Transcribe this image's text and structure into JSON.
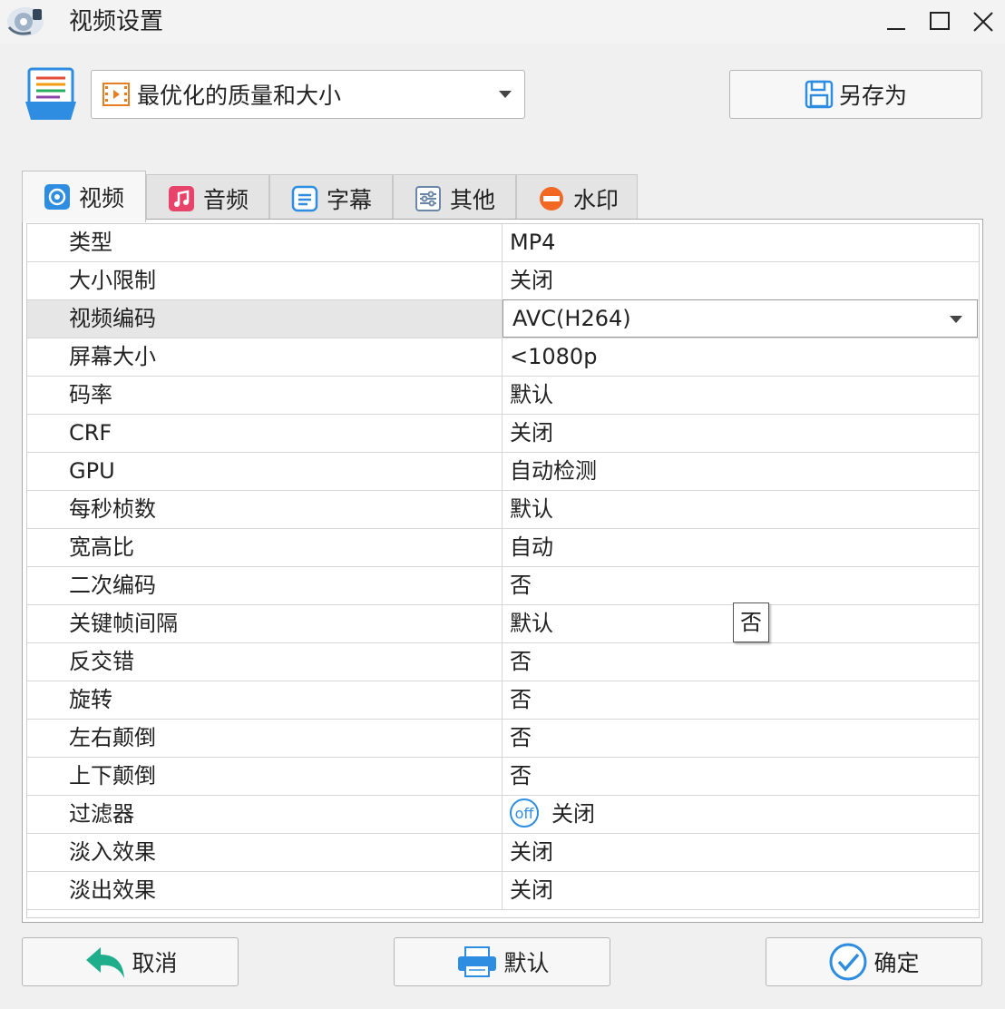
{
  "window": {
    "title": "视频设置",
    "icons": {
      "app": "converter-app-icon",
      "minimize": "minimize-icon",
      "maximize": "maximize-icon",
      "close": "close-icon"
    }
  },
  "preset": {
    "selected": "最优化的质量和大小",
    "icon": "film-icon",
    "save_as_label": "另存为"
  },
  "tabs": [
    {
      "label": "视频",
      "icon": "video-icon",
      "active": true
    },
    {
      "label": "音频",
      "icon": "music-note-icon",
      "active": false
    },
    {
      "label": "字幕",
      "icon": "subtitle-icon",
      "active": false
    },
    {
      "label": "其他",
      "icon": "sliders-icon",
      "active": false
    },
    {
      "label": "水印",
      "icon": "watermark-icon",
      "active": false
    }
  ],
  "settings": [
    {
      "key": "类型",
      "value": "MP4"
    },
    {
      "key": "大小限制",
      "value": "关闭"
    },
    {
      "key": "视频编码",
      "value": "AVC(H264)"
    },
    {
      "key": "屏幕大小",
      "value": "<1080p"
    },
    {
      "key": "码率",
      "value": "默认"
    },
    {
      "key": "CRF",
      "value": "关闭"
    },
    {
      "key": "GPU",
      "value": "自动检测"
    },
    {
      "key": "每秒桢数",
      "value": "默认"
    },
    {
      "key": "宽高比",
      "value": "自动"
    },
    {
      "key": "二次编码",
      "value": "否"
    },
    {
      "key": "关键帧间隔",
      "value": "默认"
    },
    {
      "key": "反交错",
      "value": "否"
    },
    {
      "key": "旋转",
      "value": "否"
    },
    {
      "key": "左右颠倒",
      "value": "否"
    },
    {
      "key": "上下颠倒",
      "value": "否"
    },
    {
      "key": "过滤器",
      "value": "关闭",
      "badge": "off"
    },
    {
      "key": "淡入效果",
      "value": "关闭"
    },
    {
      "key": "淡出效果",
      "value": "关闭"
    }
  ],
  "tooltip": {
    "text": "否"
  },
  "buttons": {
    "cancel": "取消",
    "default": "默认",
    "ok": "确定"
  },
  "colors": {
    "accent": "#2e8de0",
    "background": "#f0f0f0",
    "selected_row": "#e6e6e6"
  }
}
